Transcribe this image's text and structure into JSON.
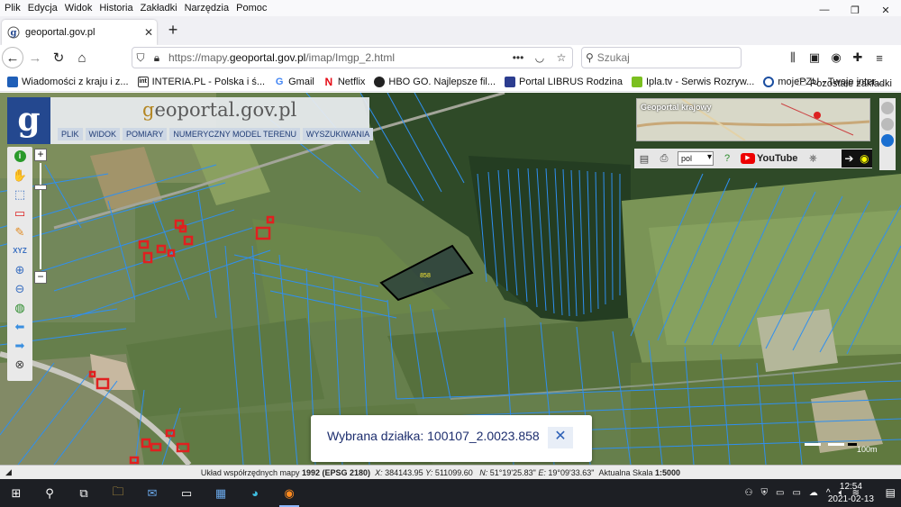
{
  "browser": {
    "menu": [
      "Plik",
      "Edycja",
      "Widok",
      "Historia",
      "Zakładki",
      "Narzędzia",
      "Pomoc"
    ],
    "window_controls": [
      "—",
      "❐",
      "✕"
    ],
    "tab_title": "geoportal.gov.pl",
    "new_tab": "+",
    "url_prefix": "https://mapy.",
    "url_domain": "geoportal.gov.pl",
    "url_suffix": "/imap/Imgp_2.html",
    "search_placeholder": "Szukaj",
    "bookmarks": [
      {
        "label": "Wiadomości z kraju i z...",
        "color": "#1f5fb8"
      },
      {
        "label": "INTERIA.PL - Polska i ś...",
        "color": "#ffffff"
      },
      {
        "label": "Gmail",
        "color": "#ffffff"
      },
      {
        "label": "Netflix",
        "color": "#e50914"
      },
      {
        "label": "HBO GO. Najlepsze fil...",
        "color": "#222222"
      },
      {
        "label": "Portal LIBRUS Rodzina",
        "color": "#2c3d8f"
      },
      {
        "label": "Ipla.tv - Serwis Rozryw...",
        "color": "#7bbf1f"
      },
      {
        "label": "mojePZU - Twoje inter...",
        "color": "#1b4ea0"
      }
    ],
    "bookmarks_other": "Pozostałe zakładki"
  },
  "geoportal": {
    "logo_letter": "g",
    "title_g": "g",
    "title_rest": "eoportal.gov.pl",
    "menu": [
      "PLIK",
      "WIDOK",
      "POMIARY",
      "NUMERYCZNY MODEL TERENU",
      "WYSZUKIWANIA"
    ],
    "krajowy_label": "Geoportal krajowy",
    "language": "pol",
    "youtube_label": "YouTube",
    "parcel_label": "858",
    "scale_label": "100m"
  },
  "popup": {
    "text": "Wybrana działka: 100107_2.0023.858",
    "close": "✕"
  },
  "status": {
    "coord_system_label": "Układ współrzędnych mapy",
    "coord_system_value": "1992 (EPSG 2180)",
    "x_label": "X:",
    "x_value": "384143.95",
    "y_label": "Y:",
    "y_value": "511099.60",
    "n_label": "N:",
    "n_value": "51°19'25.83\"",
    "e_label": "E:",
    "e_value": "19°09'33.63\"",
    "scale_label": "Aktualna Skala",
    "scale_value": "1:5000"
  },
  "taskbar": {
    "time": "12:54",
    "date": "2021-02-13"
  },
  "colors": {
    "parcel_line": "#2f8ff0",
    "selected_parcel": "#0b1e33",
    "building": "#e02020",
    "geoportal_blue": "#24488f"
  }
}
